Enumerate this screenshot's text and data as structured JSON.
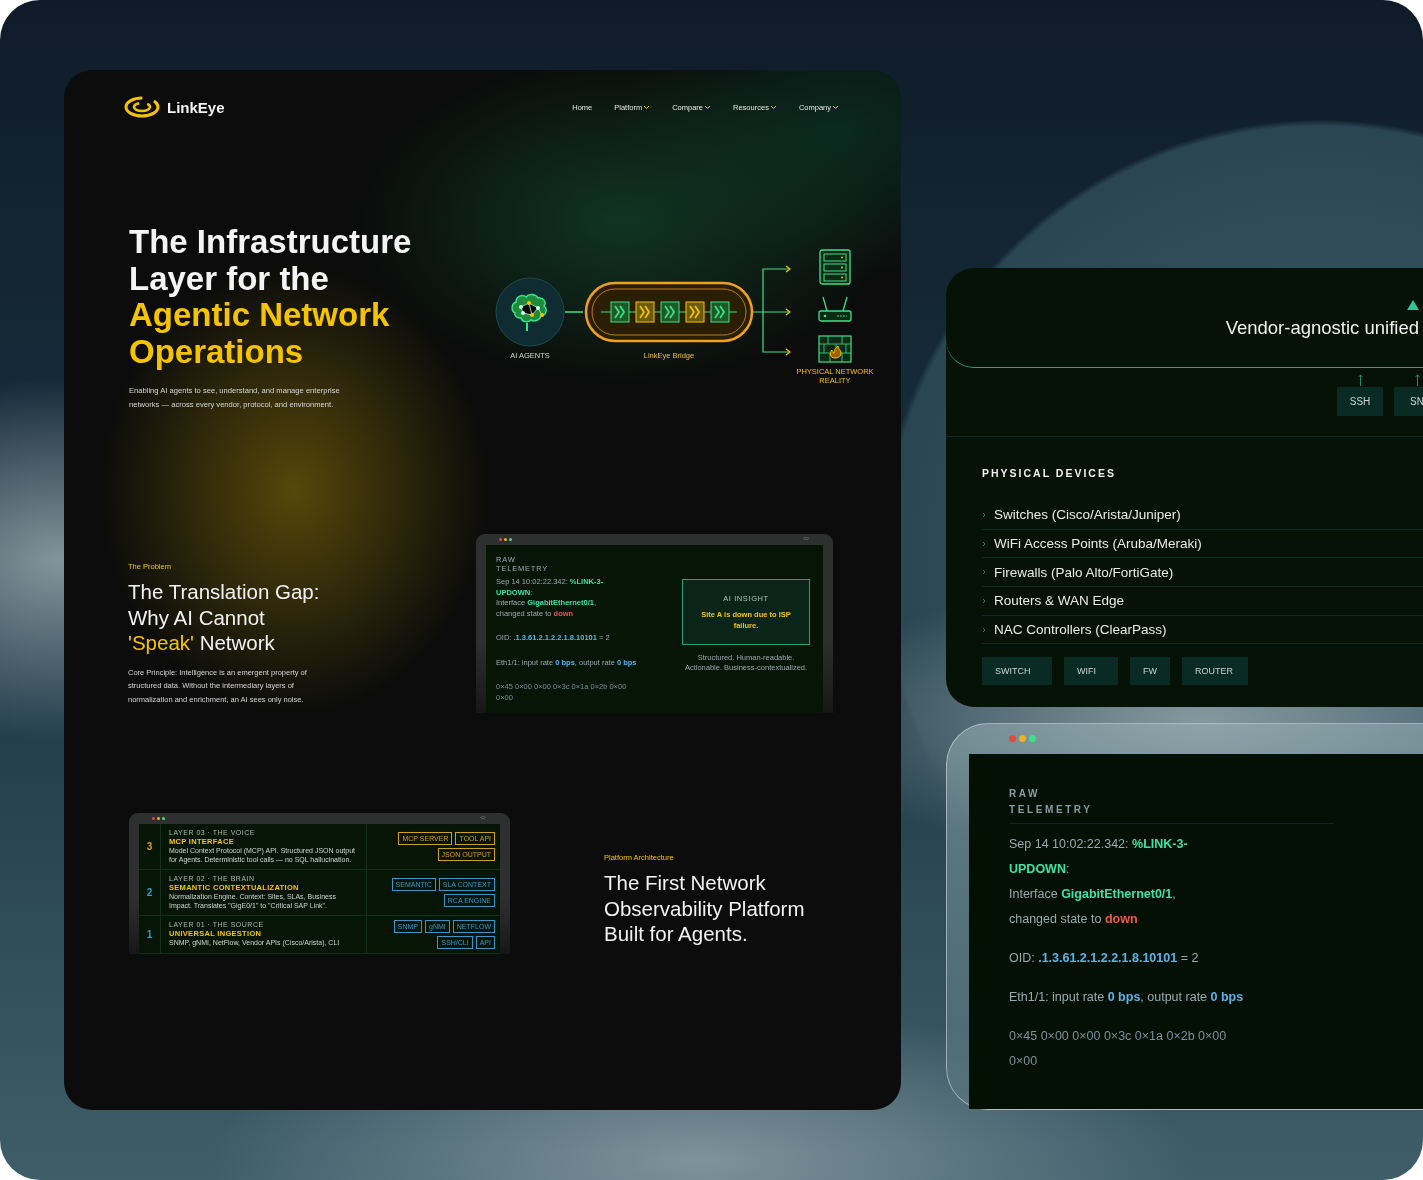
{
  "brand": {
    "name": "LinkEye"
  },
  "nav": [
    {
      "label": "Home",
      "dropdown": false
    },
    {
      "label": "Platform",
      "dropdown": true
    },
    {
      "label": "Compare",
      "dropdown": true
    },
    {
      "label": "Resources",
      "dropdown": true
    },
    {
      "label": "Company",
      "dropdown": true
    }
  ],
  "hero": {
    "title": "The Infrastructure Layer for the",
    "title_highlight": "Agentic Network Operations",
    "subtitle": "Enabling AI agents to see, understand, and manage enterprise networks — across every vendor, protocol, and environment.",
    "diagram": {
      "agents_label": "AI AGENTS",
      "bridge_label": "LinkEye Bridge",
      "reality_label": "PHYSICAL NETWORK REALITY"
    }
  },
  "problem": {
    "eyebrow": "The Problem",
    "heading": [
      {
        "text": "The Translation Gap: Why AI Cannot ",
        "highlight": false
      },
      {
        "text": "'Speak'",
        "highlight": true
      },
      {
        "text": " Network",
        "highlight": false
      }
    ],
    "body": "Core Principle: Intelligence is an emergent property of structured data. Without the intermediary layers of normalization and enrichment, an AI sees only noise.",
    "screen": {
      "title": [
        "RAW",
        "TELEMETRY"
      ],
      "blocks": [
        [
          [
            {
              "text": "Sep 14 10:02:22.342: ",
              "kind": "plain"
            },
            {
              "text": "%LINK-3-",
              "kind": "green"
            }
          ],
          [
            {
              "text": "UPDOWN",
              "kind": "green"
            },
            {
              "text": ":",
              "kind": "plain"
            }
          ],
          [
            {
              "text": "Interface ",
              "kind": "plain"
            },
            {
              "text": "GigabitEthernet0/1",
              "kind": "green"
            },
            {
              "text": ",",
              "kind": "plain"
            }
          ],
          [
            {
              "text": "changed state to ",
              "kind": "plain"
            },
            {
              "text": "down",
              "kind": "red"
            }
          ]
        ],
        [
          [
            {
              "text": "OID: ",
              "kind": "plain"
            },
            {
              "text": ".1.3.61.2.1.2.2.1.8.10101",
              "kind": "blue"
            },
            {
              "text": " = 2",
              "kind": "plain"
            }
          ]
        ],
        [
          [
            {
              "text": "Eth1/1: input rate ",
              "kind": "plain"
            },
            {
              "text": "0 bps",
              "kind": "blue"
            },
            {
              "text": ", output rate ",
              "kind": "plain"
            },
            {
              "text": "0 bps",
              "kind": "blue"
            }
          ]
        ],
        [
          [
            {
              "text": "0×45 0×00 0×00 0×3c 0×1a 0×2b 0×00",
              "kind": "dim"
            }
          ],
          [
            {
              "text": "0×00",
              "kind": "dim"
            }
          ]
        ]
      ],
      "insight_label": "AI INSIGHT",
      "insight": "Site A is down due to ISP failure.",
      "captions": [
        "Structured. Human-readable.",
        "Actionable. Business-contextualized."
      ]
    }
  },
  "architecture": {
    "eyebrow": "Platform Architecture",
    "heading": "The First Network Observability Platform Built for Agents.",
    "layers": [
      {
        "number": "3",
        "label": "LAYER 03 · THE VOICE",
        "title": "MCP INTERFACE",
        "description": "Model Context Protocol (MCP) API. Structured JSON output for Agents. Deterministic tool calls — no SQL hallucination.",
        "kind": "gold",
        "tags": [
          "MCP SERVER",
          "TOOL API",
          "JSON OUTPUT"
        ]
      },
      {
        "number": "2",
        "label": "LAYER 02 · THE BRAIN",
        "title": "SEMANTIC CONTEXTUALIZATION",
        "description": "Normalization Engine. Context: Sites, SLAs, Business Impact. Translates \"GigE0/1\" to \"Critical SAP Link\".",
        "kind": "blue",
        "tags": [
          "SEMANTIC",
          "SLA CONTEXT",
          "RCA ENGINE"
        ]
      },
      {
        "number": "1",
        "label": "LAYER 01 · THE SOURCE",
        "title": "UNIVERSAL INGESTION",
        "description": "SNMP, gNMI, NetFlow, Vendor APIs (Cisco/Arista), CLI",
        "kind": "blue",
        "tags": [
          "SNMP",
          "gNMI",
          "NETFLOW",
          "SSH/CLI",
          "API"
        ]
      }
    ]
  },
  "protocol_card": {
    "headline": "Vendor-agnostic unified",
    "protocols": [
      "SSH",
      "SN"
    ],
    "devices_title": "PHYSICAL DEVICES",
    "devices": [
      "Switches (Cisco/Arista/Juniper)",
      "WiFi Access Points (Aruba/Meraki)",
      "Firewalls (Palo Alto/FortiGate)",
      "Routers & WAN Edge",
      "NAC Controllers (ClearPass)"
    ],
    "tags": [
      "SWITCH",
      "WIFI",
      "FW",
      "ROUTER"
    ]
  },
  "telemetry_window": {
    "title": [
      "RAW",
      "TELEMETRY"
    ],
    "blocks": [
      [
        [
          {
            "text": "Sep 14 10:02:22.342: ",
            "kind": "plain"
          },
          {
            "text": "%LINK-3-",
            "kind": "green"
          }
        ],
        [
          {
            "text": "UPDOWN",
            "kind": "green"
          },
          {
            "text": ":",
            "kind": "plain"
          }
        ],
        [
          {
            "text": "Interface ",
            "kind": "plain"
          },
          {
            "text": "GigabitEthernet0/1",
            "kind": "green"
          },
          {
            "text": ",",
            "kind": "plain"
          }
        ],
        [
          {
            "text": "changed state to ",
            "kind": "plain"
          },
          {
            "text": "down",
            "kind": "red"
          }
        ]
      ],
      [
        [
          {
            "text": "OID: ",
            "kind": "plain"
          },
          {
            "text": ".1.3.61.2.1.2.2.1.8.10101",
            "kind": "blue"
          },
          {
            "text": " = 2",
            "kind": "plain"
          }
        ]
      ],
      [
        [
          {
            "text": "Eth1/1: input rate ",
            "kind": "plain"
          },
          {
            "text": "0 bps",
            "kind": "blue"
          },
          {
            "text": ", output rate ",
            "kind": "plain"
          },
          {
            "text": "0 bps",
            "kind": "blue"
          }
        ]
      ],
      [
        [
          {
            "text": "0×45 0×00 0×00 0×3c 0×1a 0×2b 0×00",
            "kind": "dim"
          }
        ],
        [
          {
            "text": "0×00",
            "kind": "dim"
          }
        ]
      ]
    ]
  }
}
